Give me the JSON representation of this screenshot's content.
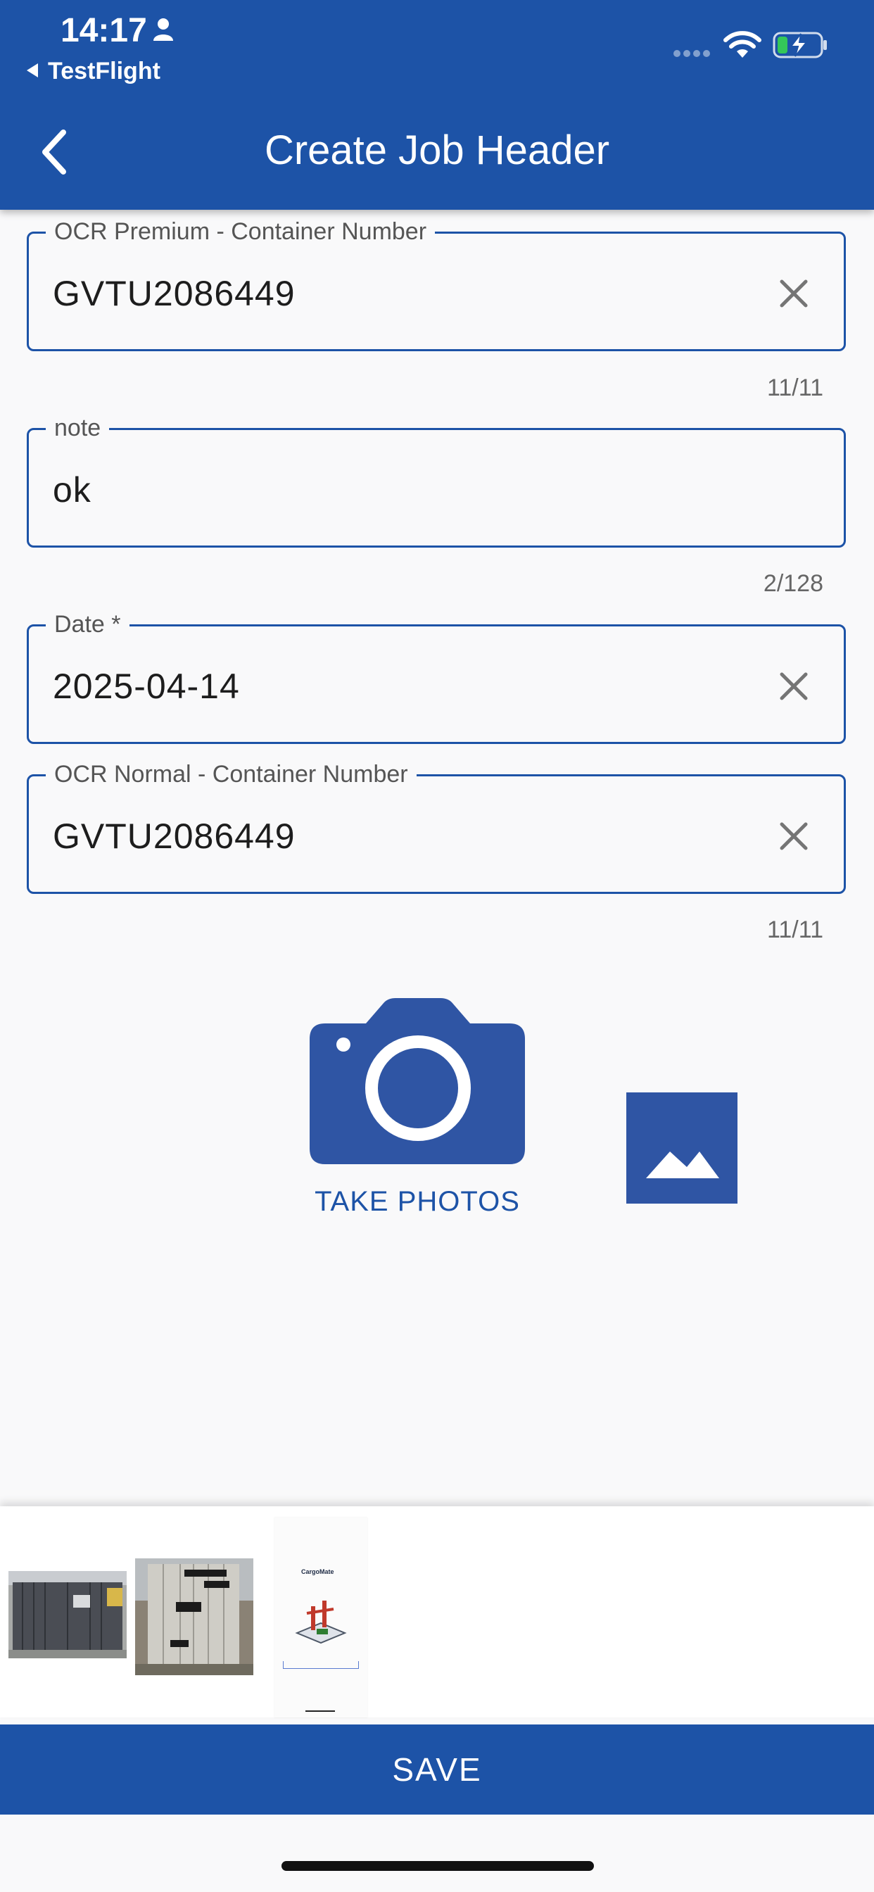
{
  "status_bar": {
    "time": "14:17",
    "back_app": "TestFlight"
  },
  "header": {
    "title": "Create Job Header"
  },
  "fields": [
    {
      "label": "OCR Premium - Container Number",
      "value": "GVTU2086449",
      "counter": "11/11"
    },
    {
      "label": "note",
      "value": "ok",
      "counter": "2/128"
    },
    {
      "label": "Date *",
      "value": "2025-04-14"
    },
    {
      "label": "OCR Normal - Container Number",
      "value": "GVTU2086449",
      "counter": "11/11"
    }
  ],
  "photos": {
    "take_photos_label": "TAKE PHOTOS",
    "thumbnails": [
      "container-photo-dark-gray",
      "container-photo-light-gray",
      "app-screenshot"
    ],
    "app_screenshot_text": "CargoMate"
  },
  "footer": {
    "save_label": "SAVE"
  },
  "colors": {
    "primary": "#1d53a7",
    "background": "#f9f9fa",
    "icon_gray": "#757575",
    "battery_green": "#34c759"
  }
}
